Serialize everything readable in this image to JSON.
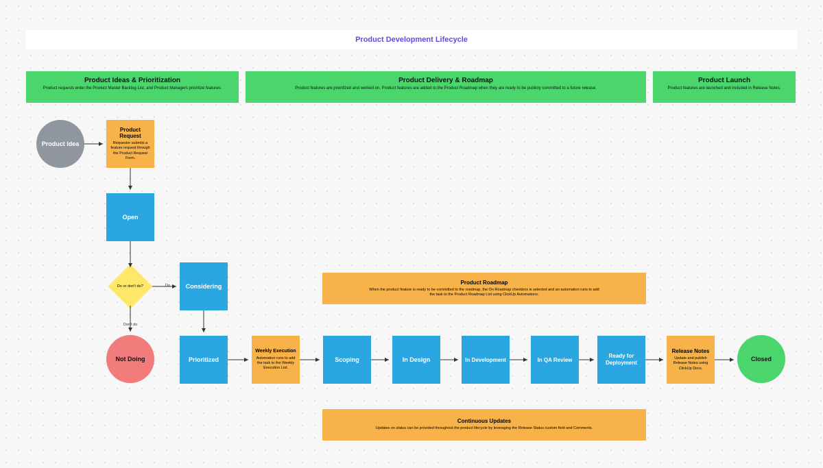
{
  "title": "Product Development Lifecycle",
  "lanes": {
    "ideas": {
      "title": "Product Ideas & Prioritization",
      "sub": "Product requests enter the Product Master Backlog List, and Product Managers prioritize features."
    },
    "delivery": {
      "title": "Product Delivery & Roadmap",
      "sub": "Product features are prioritized and worked on. Product features are added to the Product Roadmap when they are ready to be publicly committed to a future release."
    },
    "launch": {
      "title": "Product Launch",
      "sub": "Product features are launched and included in Release Notes."
    }
  },
  "nodes": {
    "idea": {
      "label": "Product Idea"
    },
    "request": {
      "label": "Product Request",
      "sub": "Requestor submits a feature request through the Product Request Form."
    },
    "open": {
      "label": "Open"
    },
    "decision": {
      "label": "Do or don't do?"
    },
    "considering": {
      "label": "Considering"
    },
    "not_doing": {
      "label": "Not Doing"
    },
    "prioritized": {
      "label": "Prioritized"
    },
    "weekly": {
      "label": "Weekly Execution",
      "sub": "Automation runs to add the task to the Weekly Execution List."
    },
    "scoping": {
      "label": "Scoping"
    },
    "design": {
      "label": "In Design"
    },
    "dev": {
      "label": "In Development"
    },
    "qa": {
      "label": "In QA Review"
    },
    "ready": {
      "label": "Ready for Deployment"
    },
    "release_notes": {
      "label": "Release Notes",
      "sub": "Update and publish Release Notes using ClickUp Docs."
    },
    "closed": {
      "label": "Closed"
    },
    "roadmap": {
      "label": "Product Roadmap",
      "sub": "When the product feature is ready to be committed to the roadmap, the On Roadmap checkbox is selected and an automation runs to add the task to the Product Roadmap List using ClickUp Automations."
    },
    "continuous": {
      "label": "Continuous Updates",
      "sub": "Updates on status can be provided throughout the product lifecycle by leveraging the Release Status custom field and Comments."
    }
  },
  "edges": {
    "do": "Do",
    "dont": "Don't do"
  }
}
